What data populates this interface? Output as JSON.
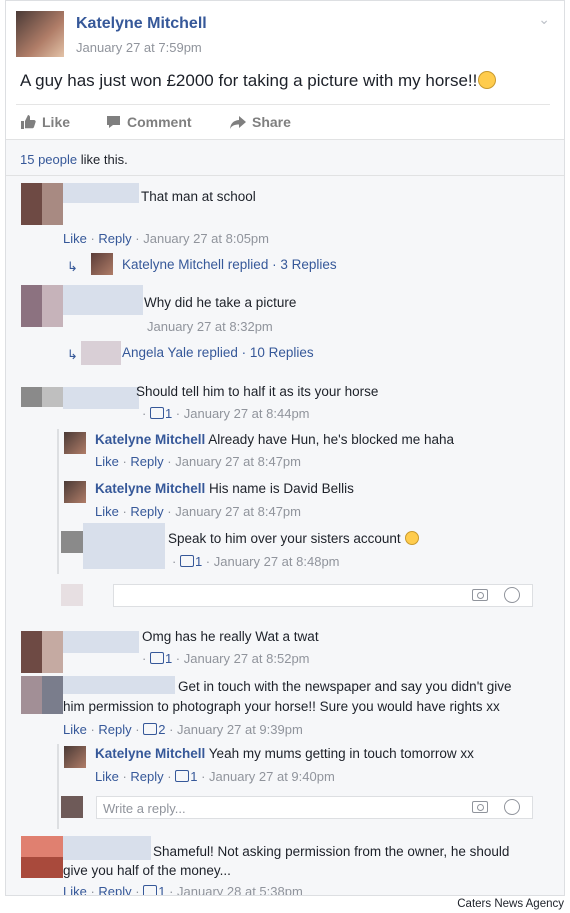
{
  "post": {
    "author": "Katelyne Mitchell",
    "time": "January 27 at 7:59pm",
    "text": "A guy has just won £2000 for taking a picture with my horse!!",
    "actions": {
      "like": "Like",
      "comment": "Comment",
      "share": "Share"
    }
  },
  "likes": {
    "count_link": "15 people",
    "suffix": " like this."
  },
  "comments": [
    {
      "text": "That man at school",
      "meta": {
        "like": "Like",
        "reply": "Reply",
        "time": "January 27 at 8:05pm"
      },
      "replied": "Katelyne Mitchell replied · 3 Replies"
    },
    {
      "text": "Why did he take a picture",
      "meta": {
        "time": "January 27 at 8:32pm"
      },
      "replied": "Angela Yale replied · 10 Replies"
    },
    {
      "text": "Should tell him to half it as its your horse",
      "meta": {
        "likes": "1",
        "time": "January 27 at 8:44pm"
      },
      "replies": [
        {
          "author": "Katelyne Mitchell",
          "text": "Already have Hun, he's blocked me haha",
          "meta": {
            "like": "Like",
            "reply": "Reply",
            "time": "January 27 at 8:47pm"
          }
        },
        {
          "author": "Katelyne Mitchell",
          "text": "His name is David Bellis",
          "meta": {
            "like": "Like",
            "reply": "Reply",
            "time": "January 27 at 8:47pm"
          }
        },
        {
          "text": "Speak to him over your sisters account",
          "meta": {
            "likes": "1",
            "time": "January 27 at 8:48pm"
          }
        }
      ]
    },
    {
      "text": "Omg has he really Wat a twat",
      "meta": {
        "likes": "1",
        "time": "January 27 at 8:52pm"
      }
    },
    {
      "text_line1": "Get in touch with the newspaper and say you didn't give",
      "text_line2": "him permission to photograph your horse!! Sure you would have rights xx",
      "meta": {
        "like": "Like",
        "reply": "Reply",
        "likes": "2",
        "time": "January 27 at 9:39pm"
      },
      "replies": [
        {
          "author": "Katelyne Mitchell",
          "text": "Yeah my mums getting in touch tomorrow xx",
          "meta": {
            "like": "Like",
            "reply": "Reply",
            "likes": "1",
            "time": "January 27 at 9:40pm"
          }
        }
      ],
      "reply_placeholder": "Write a reply..."
    },
    {
      "text_line1": "Shameful! Not asking permission from the owner, he should",
      "text_line2": "give you half of the money...",
      "meta": {
        "like": "Like",
        "reply": "Reply",
        "likes": "1",
        "time": "January 28 at 5:38pm"
      }
    }
  ],
  "credit": "Caters News Agency"
}
